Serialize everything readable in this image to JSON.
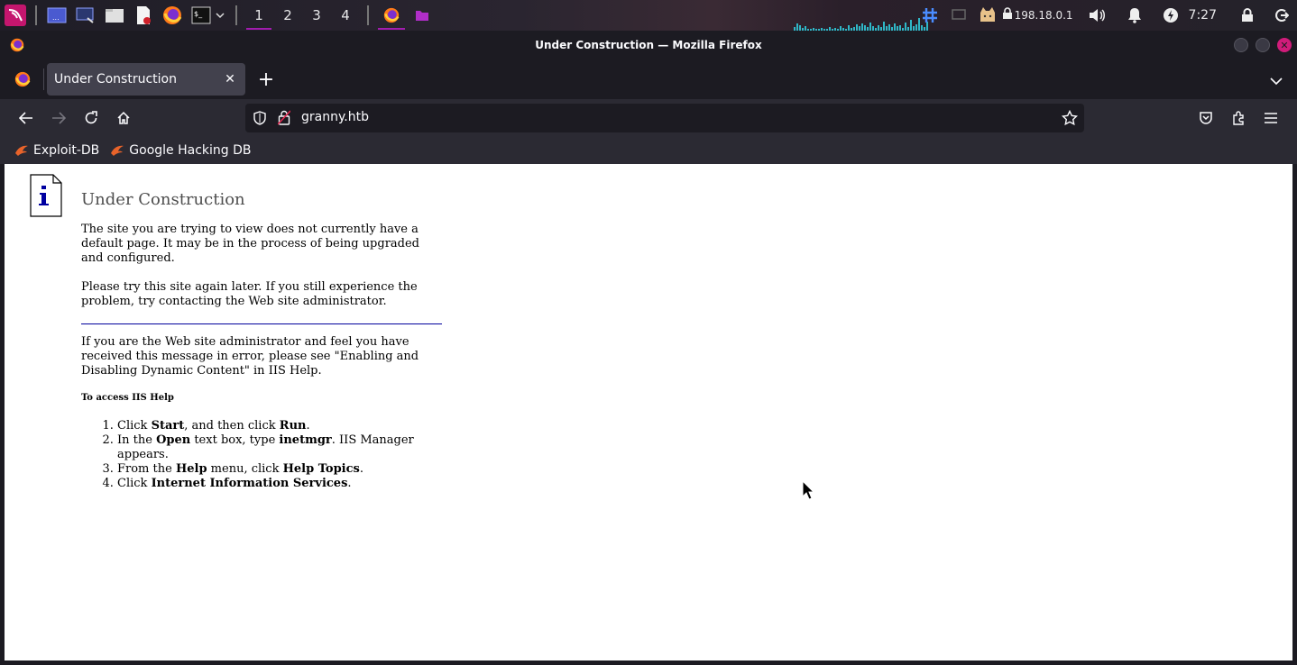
{
  "system_panel": {
    "workspaces": [
      "1",
      "2",
      "3",
      "4"
    ],
    "active_workspace": "1",
    "ip": "198.18.0.1",
    "clock": "7:27",
    "accent": "#a21caf"
  },
  "window": {
    "title": "Under Construction — Mozilla Firefox"
  },
  "tabs": [
    {
      "label": "Under Construction",
      "active": true
    }
  ],
  "nav": {
    "url": "granny.htb"
  },
  "bookmarks": [
    {
      "label": "Exploit-DB",
      "icon": "exploitdb-icon"
    },
    {
      "label": "Google Hacking DB",
      "icon": "ghdb-icon"
    }
  ],
  "page": {
    "heading": "Under Construction",
    "para1": "The site you are trying to view does not currently have a default page. It may be in the process of being upgraded and configured.",
    "para2": "Please try this site again later. If you still experience the problem, try contacting the Web site administrator.",
    "para3": "If you are the Web site administrator and feel you have received this message in error, please see \"Enabling and Disabling Dynamic Content\" in IIS Help.",
    "help_heading": "To access IIS Help",
    "steps": [
      {
        "a": "Click ",
        "b1": "Start",
        "c": ", and then click ",
        "b2": "Run",
        "d": "."
      },
      {
        "a": "In the ",
        "b1": "Open",
        "c": " text box, type ",
        "b2": "inetmgr",
        "d": ". IIS Manager appears."
      },
      {
        "a": "From the ",
        "b1": "Help",
        "c": " menu, click ",
        "b2": "Help Topics",
        "d": "."
      },
      {
        "a": "Click ",
        "b1": "Internet Information Services",
        "c": "",
        "b2": "",
        "d": "."
      }
    ]
  }
}
